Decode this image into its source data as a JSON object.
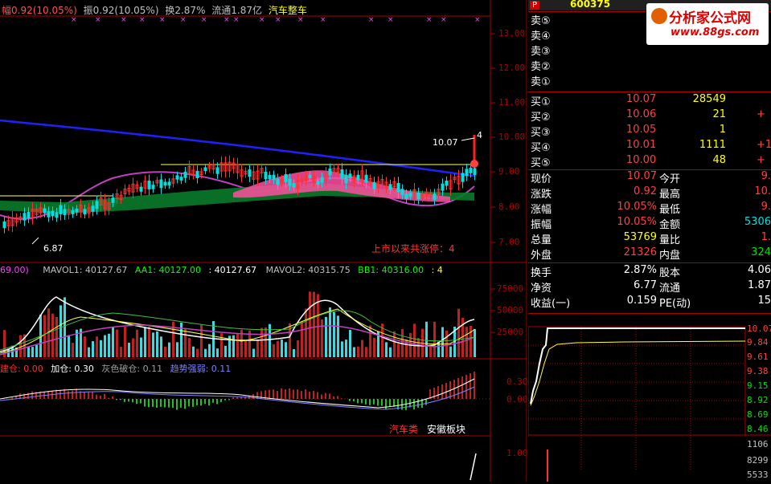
{
  "header": {
    "change_pct": "幅0.92(10.05%)",
    "amplitude": "振0.92(10.05%)",
    "turnover": "换2.87%",
    "float": "流通1.87亿",
    "sector": "汽车整车"
  },
  "price_axis": [
    "13.00",
    "12.00",
    "11.00",
    "10.00",
    "9.00",
    "8.00",
    "7.00"
  ],
  "price_annotations": {
    "high": "10.07",
    "high_mark": "4",
    "low": "6.87",
    "limit_up_text": "上市以来共涨停：4"
  },
  "volume_panel": {
    "prefix": "69.00)",
    "mavol1": "MAVOL1: 40127.67",
    "aa1": "AA1: 40127.00",
    "val1": ": 40127.67",
    "mavol2": "MAVOL2: 40315.75",
    "bb1": "BB1: 40316.00",
    "val2": ": 4",
    "axis": [
      "75000",
      "50000",
      "25000"
    ]
  },
  "indicator_panel": {
    "build": "建仓: 0.00",
    "add": "加仓: 0.30",
    "grey": "灰色破仓: 0.11",
    "trend": "趋势强弱: 0.11",
    "axis": [
      "0.30",
      "0.00"
    ],
    "tag1": "汽车类",
    "tag2": "安徽板块"
  },
  "bottom_panel": {
    "axis": "1.00"
  },
  "quote": {
    "code": "600375",
    "sell": [
      {
        "label": "卖⑤",
        "price": "",
        "vol": ""
      },
      {
        "label": "卖④",
        "price": "",
        "vol": ""
      },
      {
        "label": "卖③",
        "price": "",
        "vol": ""
      },
      {
        "label": "卖②",
        "price": "",
        "vol": ""
      },
      {
        "label": "卖①",
        "price": "",
        "vol": ""
      }
    ],
    "buy": [
      {
        "label": "买①",
        "price": "10.07",
        "vol": "28549",
        "extra": ""
      },
      {
        "label": "买②",
        "price": "10.06",
        "vol": "21",
        "extra": "+"
      },
      {
        "label": "买③",
        "price": "10.05",
        "vol": "1",
        "extra": ""
      },
      {
        "label": "买④",
        "price": "10.01",
        "vol": "1111",
        "extra": "+1("
      },
      {
        "label": "买⑤",
        "price": "10.00",
        "vol": "48",
        "extra": "+"
      }
    ],
    "stats": [
      {
        "l1": "现价",
        "v1": "10.07",
        "l2": "今开",
        "v2": "9."
      },
      {
        "l1": "涨跌",
        "v1": "0.92",
        "l2": "最高",
        "v2": "10."
      },
      {
        "l1": "涨幅",
        "v1": "10.05%",
        "l2": "最低",
        "v2": "9."
      },
      {
        "l1": "振幅",
        "v1": "10.05%",
        "l2": "金额",
        "v2": "5306"
      },
      {
        "l1": "总量",
        "v1": "53769",
        "l2": "量比",
        "v2": "1."
      },
      {
        "l1": "外盘",
        "v1": "21326",
        "l2": "内盘",
        "v2": "324"
      }
    ],
    "stats2": [
      {
        "l1": "换手",
        "v1": "2.87%",
        "l2": "股本",
        "v2": "4.06"
      },
      {
        "l1": "净资",
        "v1": "6.77",
        "l2": "流通",
        "v2": "1.87"
      },
      {
        "l1": "收益(一)",
        "v1": "0.159",
        "l2": "PE(动)",
        "v2": "15"
      }
    ]
  },
  "intraday_axis": [
    "10.07",
    "9.84",
    "9.61",
    "9.38",
    "9.15",
    "8.92",
    "8.69",
    "8.46"
  ],
  "intraday_vol_axis": [
    "1106",
    "8299",
    "5533"
  ],
  "logo": {
    "title": "分析家公式网",
    "url": "www.88gs.com"
  }
}
